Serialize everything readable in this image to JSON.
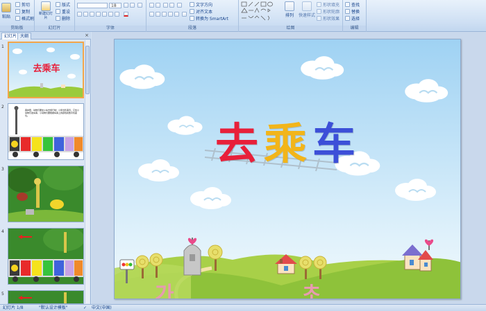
{
  "ribbon": {
    "clipboard": {
      "label": "剪贴板",
      "paste": "粘贴",
      "cut": "剪切",
      "copy": "复制",
      "format_painter": "格式刷"
    },
    "slides": {
      "label": "幻灯片",
      "new_slide": "新建幻灯片",
      "layout": "版式",
      "reset": "重设",
      "delete": "删除"
    },
    "font": {
      "label": "字体",
      "font_name": "",
      "font_size": "18"
    },
    "paragraph": {
      "label": "段落",
      "text_direction": "文字方向",
      "align_text": "对齐文本",
      "convert_smartart": "转换为 SmartArt"
    },
    "drawing": {
      "label": "绘图",
      "arrange": "排列",
      "quick_styles": "快速样式",
      "shape_fill": "形状填充",
      "shape_outline": "形状轮廓",
      "shape_effects": "形状效果"
    },
    "editing": {
      "label": "编辑",
      "find": "查找",
      "replace": "替换",
      "select": "选择"
    }
  },
  "panel": {
    "tab_slides": "幻灯片",
    "tab_outline": "大纲",
    "close": "×",
    "slide_numbers": [
      "1",
      "2",
      "3",
      "4",
      "5"
    ],
    "thumb1_title": "去乘车",
    "thumb2_text": "森林里，动物们要坐火车去旅行啦！小熊当售票员，它给小动物们发车票，小动物们要根据车票上的颜色和数字找座位。"
  },
  "slide": {
    "title_chars": [
      "去",
      "乘",
      "车"
    ]
  },
  "statusbar": {
    "slide_info": "幻灯片 1/8",
    "theme": "\"默认设计模板\"",
    "language": "中文(中国)"
  },
  "colors": {
    "sky_top": "#a7d6f4",
    "sky_bottom": "#eaf6fb",
    "title_red": "#e8203a",
    "title_yellow": "#f7c51e",
    "title_blue": "#3c4fd8",
    "grass": "#9acb3c",
    "selection": "#f3a64a"
  }
}
